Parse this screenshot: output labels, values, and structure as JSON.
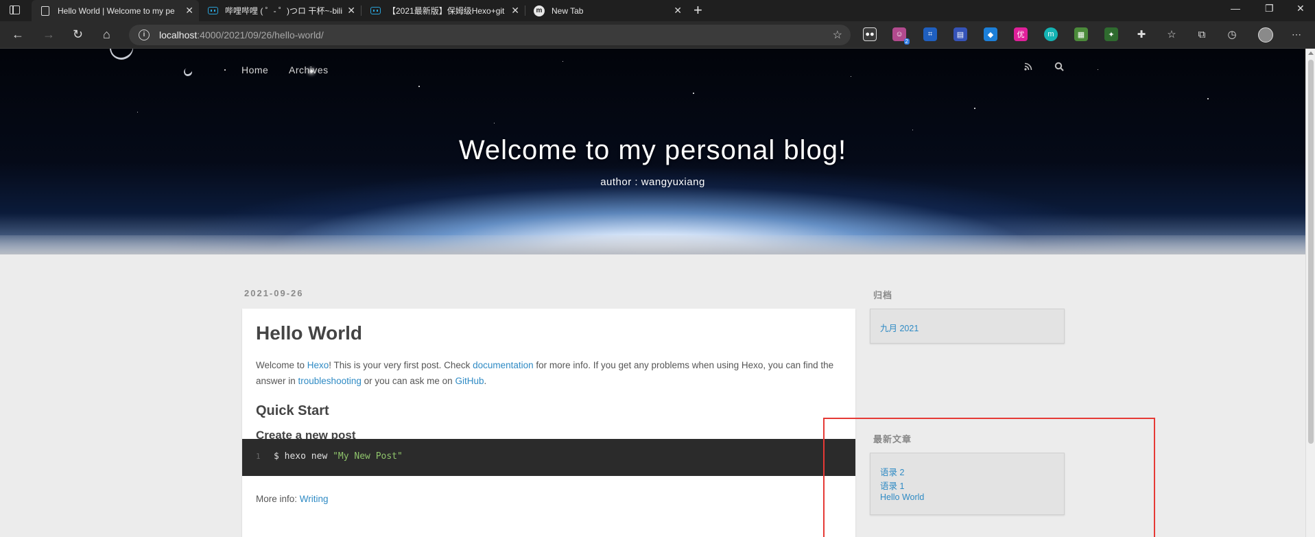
{
  "browser": {
    "tabs": [
      {
        "title": "Hello World | Welcome to my pe",
        "active": true,
        "favicon": "document-icon"
      },
      {
        "title": "哔哩哔哩 ( ゜- ゜)つロ 干杯~-bili",
        "active": false,
        "favicon": "bilibili-icon"
      },
      {
        "title": "【2021最新版】保姆级Hexo+git",
        "active": false,
        "favicon": "bilibili-icon"
      },
      {
        "title": "New Tab",
        "active": false,
        "favicon": "m-icon"
      }
    ],
    "new_tab_label": "+",
    "address": {
      "host": "localhost",
      "path": ":4000/2021/09/26/hello-world/"
    },
    "extension_badge": "2",
    "window_controls": {
      "minimize": "—",
      "restore": "❐",
      "close": "✕"
    }
  },
  "blog": {
    "nav": {
      "home": "Home",
      "archives": "Archives"
    },
    "hero_title": "Welcome to my personal blog!",
    "hero_subtitle": "author : wangyuxiang"
  },
  "post": {
    "date": "2021-09-26",
    "title": "Hello World",
    "intro": {
      "t1": "Welcome to ",
      "link_hexo": "Hexo",
      "t2": "! This is your very first post. Check ",
      "link_docs": "documentation",
      "t3": " for more info. If you get any problems when using Hexo, you can find the answer in ",
      "link_trouble": "troubleshooting",
      "t4": " or you can ask me on ",
      "link_github": "GitHub",
      "t5": "."
    },
    "h_quick_start": "Quick Start",
    "h_create_post": "Create a new post",
    "code": {
      "line_no": "1",
      "cmd": "$ hexo new ",
      "arg": "\"My New Post\""
    },
    "more_info_label": "More info: ",
    "more_info_link": "Writing"
  },
  "sidebar": {
    "archive_title": "归档",
    "archive_items": [
      "九月 2021"
    ],
    "recent_title": "最新文章",
    "recent_items": [
      "语录 2",
      "语录 1",
      "Hello World"
    ]
  },
  "colors": {
    "link": "#2e8ac4",
    "highlight": "#e53935",
    "code_bg": "#2b2b2b"
  }
}
